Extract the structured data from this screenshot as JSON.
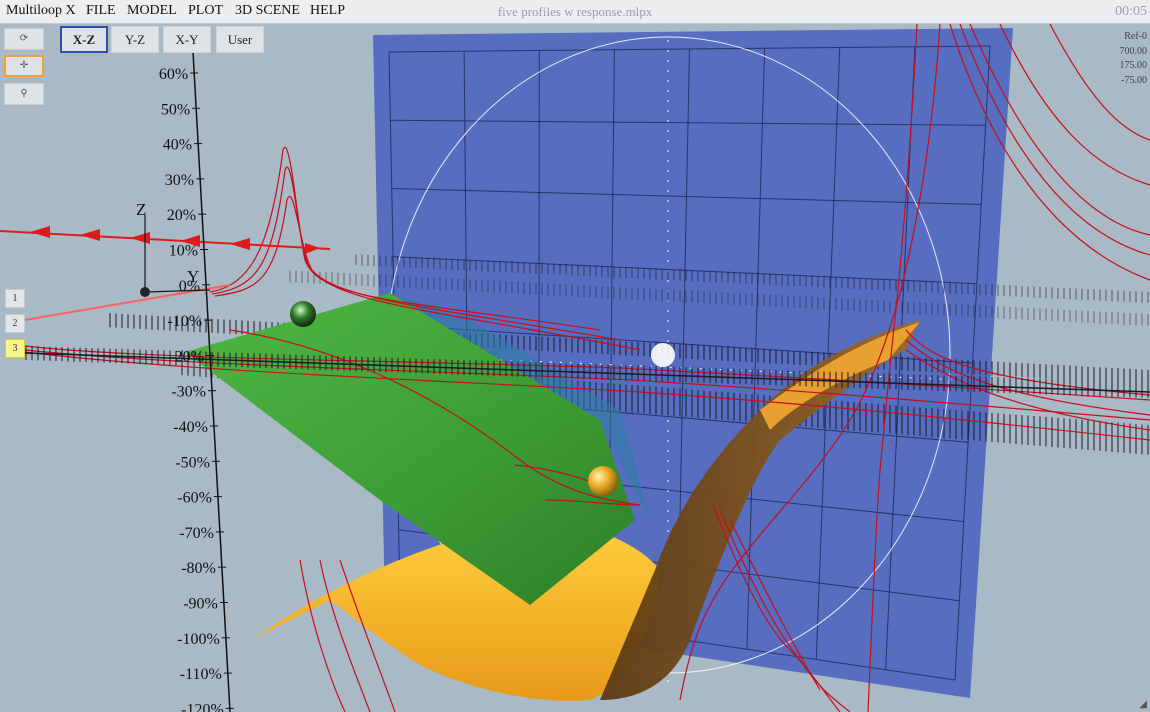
{
  "menubar": {
    "app_name": "Multiloop X",
    "items": [
      "FILE",
      "MODEL",
      "PLOT",
      "3D SCENE",
      "HELP"
    ],
    "document_title": "five profiles w response.mlpx",
    "clock": "00:05"
  },
  "toolbar": {
    "tools": [
      {
        "name": "rotate-tool",
        "icon": "rotate-icon",
        "glyph": "⟳",
        "active": false
      },
      {
        "name": "pan-tool",
        "icon": "move-icon",
        "glyph": "✛",
        "active": true
      },
      {
        "name": "zoom-tool",
        "icon": "zoom-icon",
        "glyph": "⚲",
        "active": false
      }
    ],
    "views": [
      "X-Z",
      "Y-Z",
      "X-Y",
      "User"
    ],
    "selected_view": "X-Z"
  },
  "readout": [
    "Ref-0",
    "700.00",
    "175.00",
    "-75.00"
  ],
  "profiles": [
    "1",
    "2",
    "3"
  ],
  "selected_profile": "3",
  "axis": {
    "z_label": "Z",
    "y_label": "Y",
    "tick_labels": [
      "60%",
      "50%",
      "40%",
      "30%",
      "20%",
      "10%",
      "0%",
      "-10%",
      "-20%",
      "-30%",
      "-40%",
      "-50%",
      "-60%",
      "-70%",
      "-80%",
      "-90%",
      "-100%",
      "-110%",
      "-120%"
    ]
  },
  "colors": {
    "background": "#a9bac6",
    "plane": "#4f66bf",
    "response_curve": "#c4101c",
    "green_surface": "#3f9f35",
    "orange_surface": "#f0a820",
    "arrow_line": "#e01a1a"
  }
}
